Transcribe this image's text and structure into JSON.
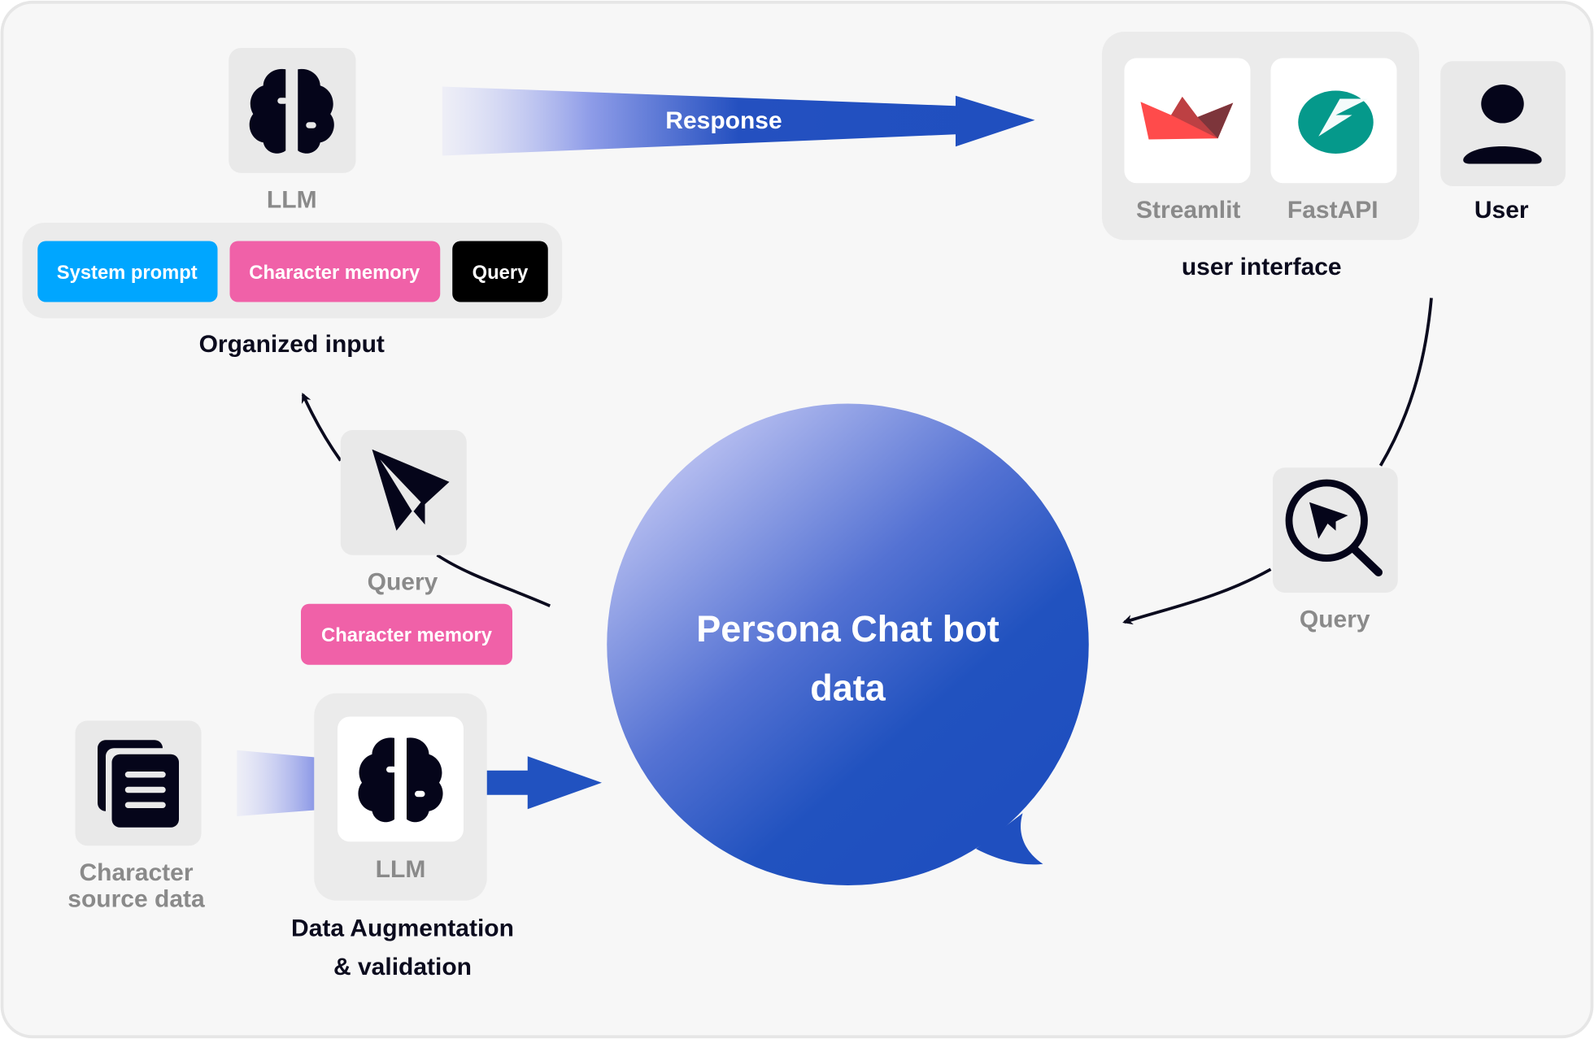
{
  "colors": {
    "background": "#f7f7f7",
    "tile": "#e9e9e9",
    "system_prompt": "#00a6ff",
    "character_memory": "#f061a8",
    "query": "#000000",
    "flow_blue": "#1f4fbf",
    "streamlit_red": "#ff4b4b",
    "fastapi_teal": "#05998b"
  },
  "llm_top": {
    "label": "LLM",
    "icon": "brain-icon"
  },
  "organized_input": {
    "pills": [
      {
        "label": "System prompt"
      },
      {
        "label": "Character memory"
      },
      {
        "label": "Query"
      }
    ],
    "label": "Organized input"
  },
  "response_arrow": {
    "label": "Response"
  },
  "user_interface": {
    "streamlit": {
      "label": "Streamlit",
      "icon": "streamlit-logo"
    },
    "fastapi": {
      "label": "FastAPI",
      "icon": "fastapi-logo"
    },
    "label": "user interface"
  },
  "user": {
    "label": "User",
    "icon": "user-icon"
  },
  "query_right": {
    "label": "Query",
    "icon": "search-send-icon"
  },
  "center": {
    "line1": "Persona Chat bot",
    "line2": "data"
  },
  "query_left": {
    "label": "Query",
    "icon": "paper-plane-icon",
    "memory_pill": "Character memory"
  },
  "source": {
    "line1": "Character",
    "line2": "source data",
    "icon": "documents-icon"
  },
  "llm_bottom": {
    "label": "LLM",
    "icon": "brain-icon",
    "caption1": "Data Augmentation",
    "caption2": "& validation"
  }
}
